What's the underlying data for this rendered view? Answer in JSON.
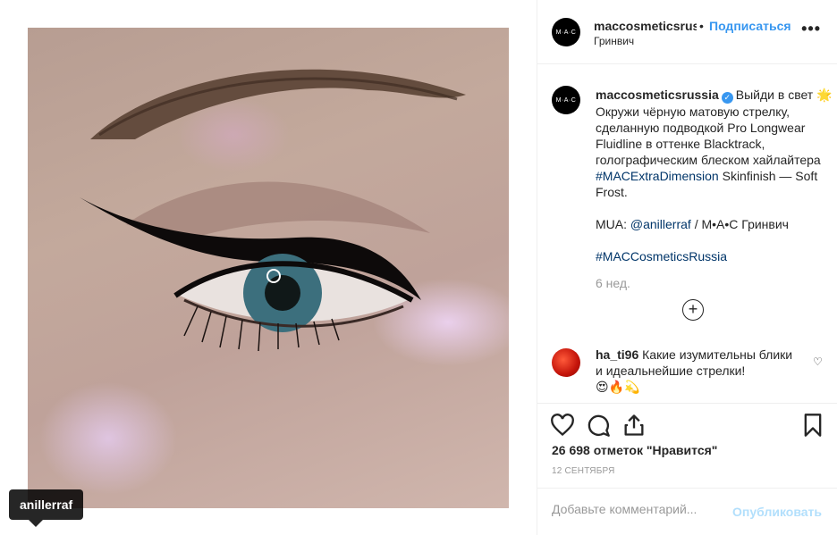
{
  "media": {
    "image_desc": "eye-makeup-photo",
    "user_tag": "anillerraf"
  },
  "header": {
    "avatar_text": "M·A·C",
    "username": "maccosmeticsrussia",
    "separator": "•",
    "follow_label": "Подписаться",
    "location": "Гринвич",
    "more_icon": "more-options-icon"
  },
  "caption": {
    "username": "maccosmeticsrussia",
    "verified_icon": "verified-badge-icon",
    "line1": "Выйди в свет",
    "sparkle": "🌟",
    "body": "Окружи чёрную матовую стрелку, сделанную подводкой Pro Longwear Fluidline в оттенке Blacktrack, голографическим блеском хайлайтера",
    "hashtag1": "#MACExtraDimension",
    "body_end": "Skinfinish — Soft Frost.",
    "mua_label": "MUA:",
    "mua_handle": "@anillerraf",
    "mua_rest": "/ M•A•C Гринвич",
    "hashtag2": "#MACCosmeticsRussia",
    "age": "6 нед.",
    "load_more_icon": "plus-circle-icon"
  },
  "comment": {
    "username": "ha_ti96",
    "text": "Какие изумительны блики и идеальнейшие стрелки!",
    "emoji": "😍🔥💫",
    "like_icon": "heart-icon"
  },
  "actions": {
    "likes": "26 698 отметок \"Нравится\"",
    "date": "12 СЕНТЯБРЯ",
    "icons": [
      "heart-icon",
      "comment-icon",
      "share-icon",
      "bookmark-icon"
    ]
  },
  "add_comment": {
    "placeholder": "Добавьте комментарий...",
    "post_label": "Опубликовать"
  }
}
